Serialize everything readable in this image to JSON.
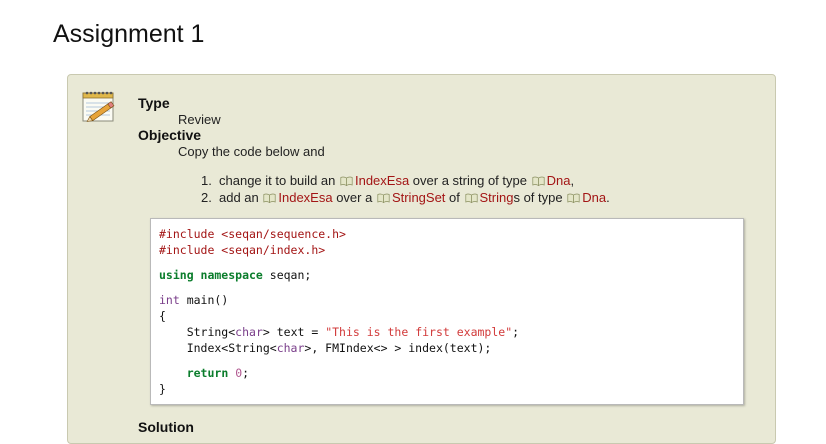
{
  "page": {
    "title": "Assignment 1"
  },
  "assignment": {
    "type_label": "Type",
    "type_value": "Review",
    "objective_label": "Objective",
    "objective_text": "Copy the code below and",
    "steps": [
      {
        "number": "1.",
        "parts": [
          {
            "text": "change it to build an ",
            "ref": false
          },
          {
            "text": "IndexEsa",
            "ref": true
          },
          {
            "text": " over a string of type ",
            "ref": false
          },
          {
            "text": "Dna",
            "ref": true
          },
          {
            "text": ",",
            "ref": false
          }
        ]
      },
      {
        "number": "2.",
        "parts": [
          {
            "text": "add an ",
            "ref": false
          },
          {
            "text": "IndexEsa",
            "ref": true
          },
          {
            "text": " over a ",
            "ref": false
          },
          {
            "text": "StringSet",
            "ref": true
          },
          {
            "text": " of ",
            "ref": false
          },
          {
            "text": "String",
            "ref": true
          },
          {
            "text": "s of type ",
            "ref": false
          },
          {
            "text": "Dna",
            "ref": true
          },
          {
            "text": ".",
            "ref": false
          }
        ]
      }
    ],
    "code_lines": [
      [
        {
          "t": "#include <seqan/sequence.h>",
          "c": "pp"
        }
      ],
      [
        {
          "t": "#include <seqan/index.h>",
          "c": "pp"
        }
      ],
      [],
      [
        {
          "t": "using namespace",
          "c": "kw"
        },
        {
          "t": " seqan;",
          "c": ""
        }
      ],
      [],
      [
        {
          "t": "int",
          "c": "ty"
        },
        {
          "t": " main()",
          "c": ""
        }
      ],
      [
        {
          "t": "{",
          "c": ""
        }
      ],
      [
        {
          "t": "    String<",
          "c": ""
        },
        {
          "t": "char",
          "c": "ty"
        },
        {
          "t": "> text = ",
          "c": ""
        },
        {
          "t": "\"This is the first example\"",
          "c": "str"
        },
        {
          "t": ";",
          "c": ""
        }
      ],
      [
        {
          "t": "    Index<String<",
          "c": ""
        },
        {
          "t": "char",
          "c": "ty"
        },
        {
          "t": ">, FMIndex<> > index(text);",
          "c": ""
        }
      ],
      [],
      [
        {
          "t": "    ",
          "c": ""
        },
        {
          "t": "return",
          "c": "kw"
        },
        {
          "t": " ",
          "c": ""
        },
        {
          "t": "0",
          "c": "num-lit"
        },
        {
          "t": ";",
          "c": ""
        }
      ],
      [
        {
          "t": "}",
          "c": ""
        }
      ]
    ],
    "solution_label": "Solution"
  },
  "icons": {
    "assignment_icon": "notepad-pencil-icon",
    "reference_icon": "book-link-icon"
  },
  "colors": {
    "box_background": "#e9e9d6",
    "reference_link": "#a31515",
    "keyword": "#0b7d2c",
    "string_literal": "#d23a3a"
  }
}
